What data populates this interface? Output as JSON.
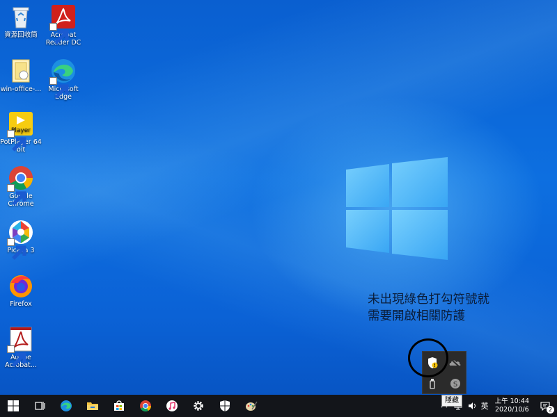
{
  "desktop": {
    "icons": [
      {
        "label": "資源回收筒",
        "icon": "recycle-bin-icon"
      },
      {
        "label": "Acrobat Reader DC",
        "icon": "acrobat-reader-icon"
      },
      {
        "label": "win-office-...",
        "icon": "folder-icon"
      },
      {
        "label": "Microsoft Edge",
        "icon": "edge-icon"
      },
      {
        "label": "PotPlayer 64 bit",
        "icon": "potplayer-icon"
      },
      {
        "label": "Google Chrome",
        "icon": "chrome-icon"
      },
      {
        "label": "Picasa 3",
        "icon": "picasa-icon"
      },
      {
        "label": "Firefox",
        "icon": "firefox-icon"
      },
      {
        "label": "Adobe Acrobat...",
        "icon": "adobe-acrobat-icon"
      }
    ]
  },
  "annotation": {
    "line1": "未出現綠色打勾符號就",
    "line2": "需要開啟相關防護"
  },
  "tray_popup": {
    "tooltip": "隱藏",
    "icons": [
      "windows-security-warning-icon",
      "onedrive-icon",
      "usb-device-icon",
      "skype-icon"
    ]
  },
  "taskbar": {
    "apps": [
      "start-icon",
      "task-view-icon",
      "edge-icon",
      "file-explorer-icon",
      "store-icon",
      "chrome-icon",
      "itunes-icon",
      "settings-icon",
      "windows-security-icon",
      "paint-icon"
    ],
    "ime": "英",
    "time": "上午 10:44",
    "date": "2020/10/6",
    "notification_count": "2"
  },
  "colors": {
    "accent": "#0b62d6",
    "taskbar": "#13151a"
  }
}
